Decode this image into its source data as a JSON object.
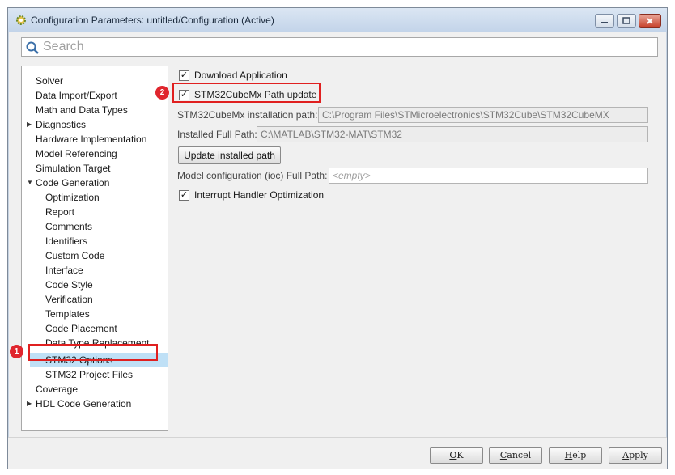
{
  "window": {
    "title": "Configuration Parameters: untitled/Configuration (Active)",
    "icon": "matlab-gear-icon"
  },
  "search": {
    "placeholder": "Search"
  },
  "tree": {
    "items": [
      {
        "label": "Solver"
      },
      {
        "label": "Data Import/Export"
      },
      {
        "label": "Math and Data Types"
      },
      {
        "label": "Diagnostics",
        "expander": "collapsed"
      },
      {
        "label": "Hardware Implementation"
      },
      {
        "label": "Model Referencing"
      },
      {
        "label": "Simulation Target"
      },
      {
        "label": "Code Generation",
        "expander": "expanded"
      },
      {
        "label": "Optimization"
      },
      {
        "label": "Report"
      },
      {
        "label": "Comments"
      },
      {
        "label": "Identifiers"
      },
      {
        "label": "Custom Code"
      },
      {
        "label": "Interface"
      },
      {
        "label": "Code Style"
      },
      {
        "label": "Verification"
      },
      {
        "label": "Templates"
      },
      {
        "label": "Code Placement"
      },
      {
        "label": "Data Type Replacement"
      },
      {
        "label": "STM32 Options",
        "selected": true
      },
      {
        "label": "STM32 Project Files"
      },
      {
        "label": "Coverage"
      },
      {
        "label": "HDL Code Generation",
        "expander": "collapsed"
      }
    ]
  },
  "panel": {
    "download_application": {
      "label": "Download Application",
      "checked": true
    },
    "path_update": {
      "label": "STM32CubeMx Path update",
      "checked": true
    },
    "install_path": {
      "label": "STM32CubeMx installation path:",
      "value": "C:\\Program Files\\STMicroelectronics\\STM32Cube\\STM32CubeMX"
    },
    "full_path": {
      "label": "Installed Full Path:",
      "value": "C:\\MATLAB\\STM32-MAT\\STM32"
    },
    "update_button": "Update installed path",
    "ioc_path": {
      "label": "Model configuration (ioc) Full Path:",
      "placeholder": "<empty>"
    },
    "interrupt_opt": {
      "label": "Interrupt Handler Optimization",
      "checked": true
    }
  },
  "annotations": {
    "badge1": "1",
    "badge2": "2",
    "highlight_color": "#e02020"
  },
  "footer": {
    "ok": {
      "first": "O",
      "rest": "K"
    },
    "cancel": {
      "first": "C",
      "rest": "ancel"
    },
    "help": {
      "first": "H",
      "rest": "elp"
    },
    "apply": {
      "first": "A",
      "rest": "pply"
    }
  },
  "colors": {
    "selection": "#bfe0f6",
    "badge": "#e0262e"
  }
}
